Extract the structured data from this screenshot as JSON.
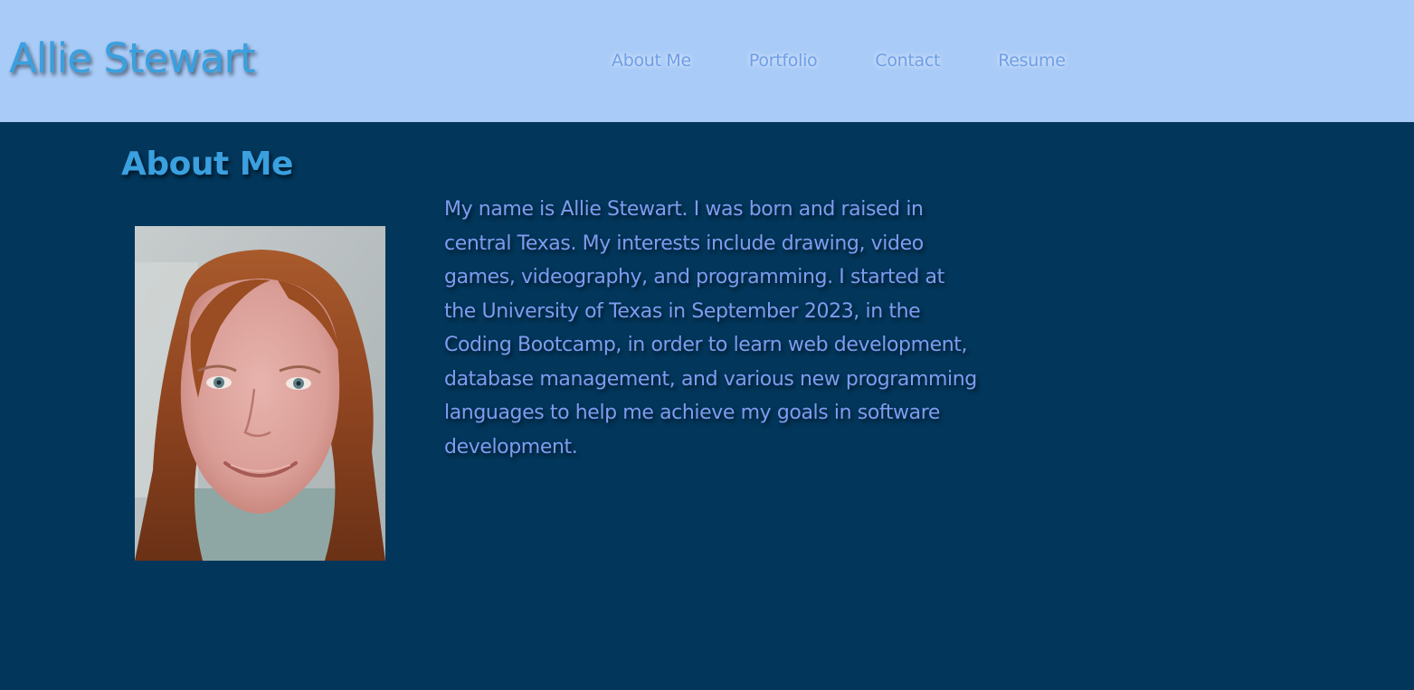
{
  "header": {
    "site_title": "Allie Stewart",
    "nav": [
      {
        "label": "About Me"
      },
      {
        "label": "Portfolio"
      },
      {
        "label": "Contact"
      },
      {
        "label": "Resume"
      }
    ]
  },
  "about": {
    "heading": "About Me",
    "bio": "My name is Allie Stewart. I was born and raised in central Texas. My interests include drawing, video games, videography, and programming. I started at the University of Texas in September 2023, in the Coding Bootcamp, in order to learn web development, database management, and various new programming languages to help me achieve my goals in software development."
  },
  "colors": {
    "header_bg": "#a9cbf7",
    "page_bg": "#02365a",
    "accent": "#3aa0e0",
    "nav_link": "#6f9ee8",
    "body_text": "#7e9cf0"
  }
}
